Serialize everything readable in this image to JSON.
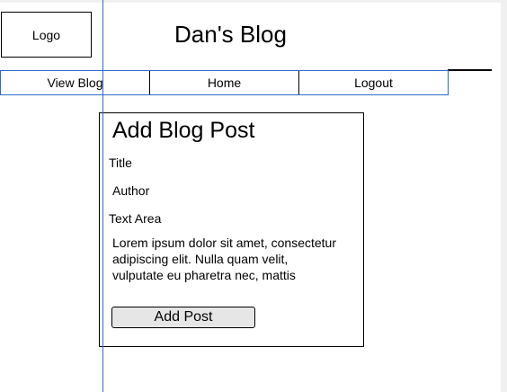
{
  "header": {
    "logo_text": "Logo",
    "site_title": "Dan's Blog"
  },
  "nav": {
    "items": [
      {
        "label": "View Blog"
      },
      {
        "label": "Home"
      },
      {
        "label": "Logout"
      }
    ]
  },
  "form": {
    "heading": "Add Blog Post",
    "title_label": "Title",
    "author_label": "Author",
    "textarea_label": "Text Area",
    "textarea_value": "Lorem ipsum dolor sit amet, consectetur adipiscing elit. Nulla quam velit, vulputate eu pharetra nec, mattis",
    "submit_label": "Add Post"
  },
  "colors": {
    "guide_blue": "#2f6bc9",
    "button_fill": "#e6e6e6",
    "border": "#000000"
  }
}
